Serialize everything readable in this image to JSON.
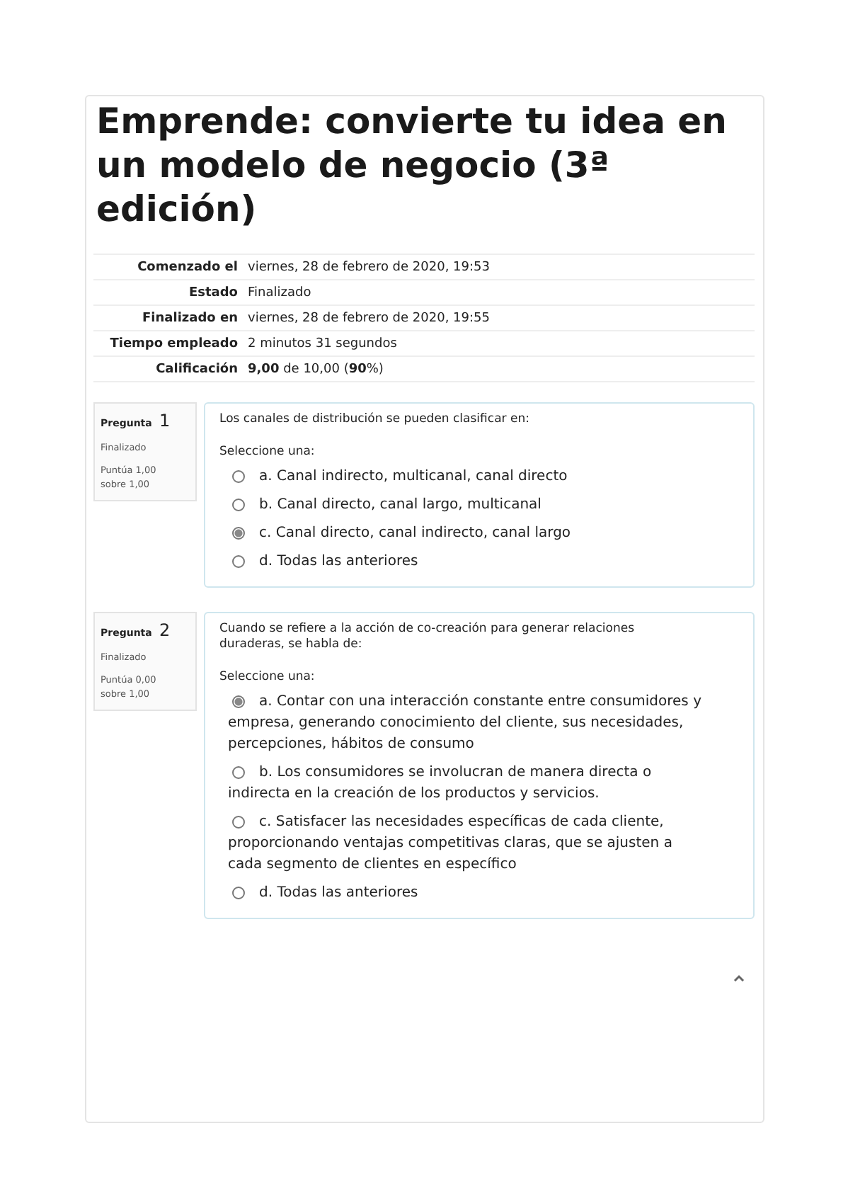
{
  "title": "Emprende: convierte tu idea en un modelo de negocio (3ª edición)",
  "summary": [
    {
      "label": "Comenzado el",
      "value": "viernes, 28 de febrero de 2020, 19:53"
    },
    {
      "label": "Estado",
      "value": "Finalizado"
    },
    {
      "label": "Finalizado en",
      "value": "viernes, 28 de febrero de 2020, 19:55"
    },
    {
      "label": "Tiempo empleado",
      "value": "2 minutos 31 segundos"
    },
    {
      "label": "Calificación",
      "value": "**9,00** de 10,00 (**90**%)"
    }
  ],
  "questions": [
    {
      "label": "Pregunta",
      "number": "1",
      "state": "Finalizado",
      "score": "Puntúa 1,00 sobre 1,00",
      "text": "Los canales de distribución se pueden clasificar en:",
      "prompt": "Seleccione una:",
      "options": [
        {
          "text": "a. Canal indirecto, multicanal, canal directo",
          "selected": false
        },
        {
          "text": "b. Canal directo, canal largo, multicanal",
          "selected": false
        },
        {
          "text": "c. Canal directo, canal indirecto, canal largo",
          "selected": true
        },
        {
          "text": "d. Todas las anteriores",
          "selected": false
        }
      ]
    },
    {
      "label": "Pregunta",
      "number": "2",
      "state": "Finalizado",
      "score": "Puntúa 0,00 sobre 1,00",
      "text": "Cuando se refiere a la acción de co-creación para generar relaciones duraderas, se habla de:",
      "prompt": "Seleccione una:",
      "options": [
        {
          "text": "a. Contar con una interacción constante entre consumidores y empresa, generando conocimiento del cliente, sus necesidades, percepciones, hábitos de consumo",
          "selected": true
        },
        {
          "text": "b. Los consumidores se involucran de manera directa o indirecta en la creación de los productos y servicios.",
          "selected": false
        },
        {
          "text": "c. Satisfacer las necesidades específicas de cada cliente, proporcionando ventajas competitivas claras, que se ajusten a cada segmento de clientes en específico",
          "selected": false
        },
        {
          "text": "d. Todas las anteriores",
          "selected": false
        }
      ]
    }
  ]
}
